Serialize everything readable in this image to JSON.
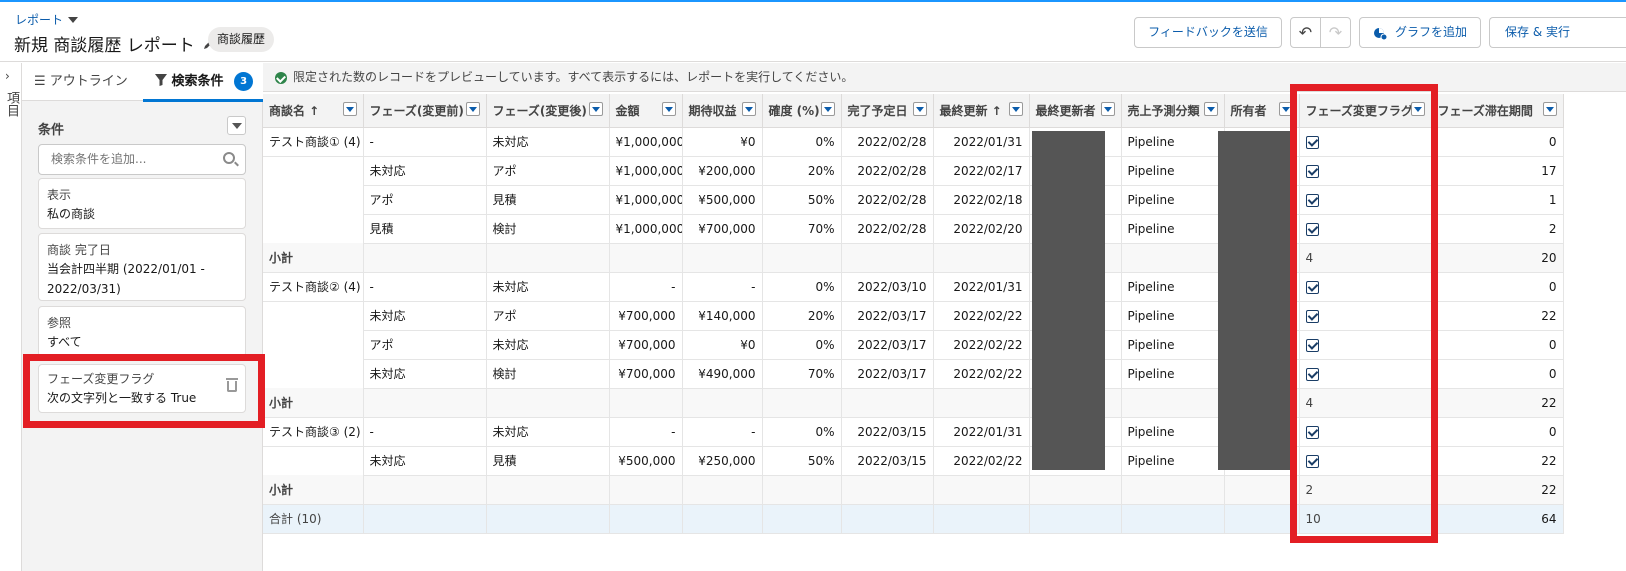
{
  "header": {
    "breadcrumb": "レポート",
    "title": "新規 商談履歴 レポート",
    "report_type_badge": "商談履歴",
    "buttons": {
      "feedback": "フィードバックを送信",
      "undo": "↶",
      "redo": "↷",
      "add_chart": "グラフを追加",
      "save_run": "保存 & 実行"
    }
  },
  "rail": {
    "expand": "›",
    "label": "項目"
  },
  "panel": {
    "tabs": {
      "outline": "アウトライン",
      "filters": "検索条件",
      "filter_count": "3"
    },
    "section_label": "条件",
    "search_placeholder": "検索条件を追加...",
    "filters": [
      {
        "key": "表示",
        "value": "私の商談"
      },
      {
        "key": "商談 完了日",
        "value": "当会計四半期 (2022/01/01 - 2022/03/31)"
      },
      {
        "key": "参照",
        "value": "すべて"
      },
      {
        "key": "フェーズ変更フラグ",
        "value": "次の文字列と一致する True"
      }
    ]
  },
  "notice": "限定された数のレコードをプレビューしています。すべて表示するには、レポートを実行してください。",
  "table": {
    "columns": [
      "商談名 ↑",
      "フェーズ(変更前)",
      "フェーズ(変更後)",
      "金額",
      "期待収益",
      "確度 (%)",
      "完了予定日",
      "最終更新 ↑",
      "最終更新者",
      "売上予測分類",
      "所有者",
      "フェーズ変更フラグ",
      "フェーズ滞在期間"
    ],
    "groups": [
      {
        "name": "テスト商談① (4)",
        "rows": [
          {
            "before": "-",
            "after": "未対応",
            "amount": "¥1,000,000",
            "expected": "¥0",
            "prob": "0%",
            "close": "2022/02/28",
            "modified": "2022/01/31",
            "forecast": "Pipeline",
            "duration": "0"
          },
          {
            "before": "未対応",
            "after": "アポ",
            "amount": "¥1,000,000",
            "expected": "¥200,000",
            "prob": "20%",
            "close": "2022/02/28",
            "modified": "2022/02/17",
            "forecast": "Pipeline",
            "duration": "17"
          },
          {
            "before": "アポ",
            "after": "見積",
            "amount": "¥1,000,000",
            "expected": "¥500,000",
            "prob": "50%",
            "close": "2022/02/28",
            "modified": "2022/02/18",
            "forecast": "Pipeline",
            "duration": "1"
          },
          {
            "before": "見積",
            "after": "検討",
            "amount": "¥1,000,000",
            "expected": "¥700,000",
            "prob": "70%",
            "close": "2022/02/28",
            "modified": "2022/02/20",
            "forecast": "Pipeline",
            "duration": "2"
          }
        ],
        "subtotal": {
          "label": "小計",
          "flag": "4",
          "duration": "20"
        }
      },
      {
        "name": "テスト商談② (4)",
        "rows": [
          {
            "before": "-",
            "after": "未対応",
            "amount": "-",
            "expected": "-",
            "prob": "0%",
            "close": "2022/03/10",
            "modified": "2022/01/31",
            "forecast": "Pipeline",
            "duration": "0"
          },
          {
            "before": "未対応",
            "after": "アポ",
            "amount": "¥700,000",
            "expected": "¥140,000",
            "prob": "20%",
            "close": "2022/03/17",
            "modified": "2022/02/22",
            "forecast": "Pipeline",
            "duration": "22"
          },
          {
            "before": "アポ",
            "after": "未対応",
            "amount": "¥700,000",
            "expected": "¥0",
            "prob": "0%",
            "close": "2022/03/17",
            "modified": "2022/02/22",
            "forecast": "Pipeline",
            "duration": "0"
          },
          {
            "before": "未対応",
            "after": "検討",
            "amount": "¥700,000",
            "expected": "¥490,000",
            "prob": "70%",
            "close": "2022/03/17",
            "modified": "2022/02/22",
            "forecast": "Pipeline",
            "duration": "0"
          }
        ],
        "subtotal": {
          "label": "小計",
          "flag": "4",
          "duration": "22"
        }
      },
      {
        "name": "テスト商談③ (2)",
        "rows": [
          {
            "before": "-",
            "after": "未対応",
            "amount": "-",
            "expected": "-",
            "prob": "0%",
            "close": "2022/03/15",
            "modified": "2022/01/31",
            "forecast": "Pipeline",
            "duration": "0"
          },
          {
            "before": "未対応",
            "after": "見積",
            "amount": "¥500,000",
            "expected": "¥250,000",
            "prob": "50%",
            "close": "2022/03/15",
            "modified": "2022/02/22",
            "forecast": "Pipeline",
            "duration": "22"
          }
        ],
        "subtotal": {
          "label": "小計",
          "flag": "2",
          "duration": "22"
        }
      }
    ],
    "total": {
      "label": "合計 (10)",
      "flag": "10",
      "duration": "64"
    }
  },
  "colors": {
    "highlight": "#e31e24",
    "brand": "#0176d3",
    "mask": "#555555"
  },
  "icons": [
    "pencil-icon",
    "undo-icon",
    "redo-icon",
    "chart-add-icon",
    "list-icon",
    "filter-icon",
    "search-icon",
    "trash-icon",
    "success-icon",
    "checkbox-checked-icon"
  ]
}
